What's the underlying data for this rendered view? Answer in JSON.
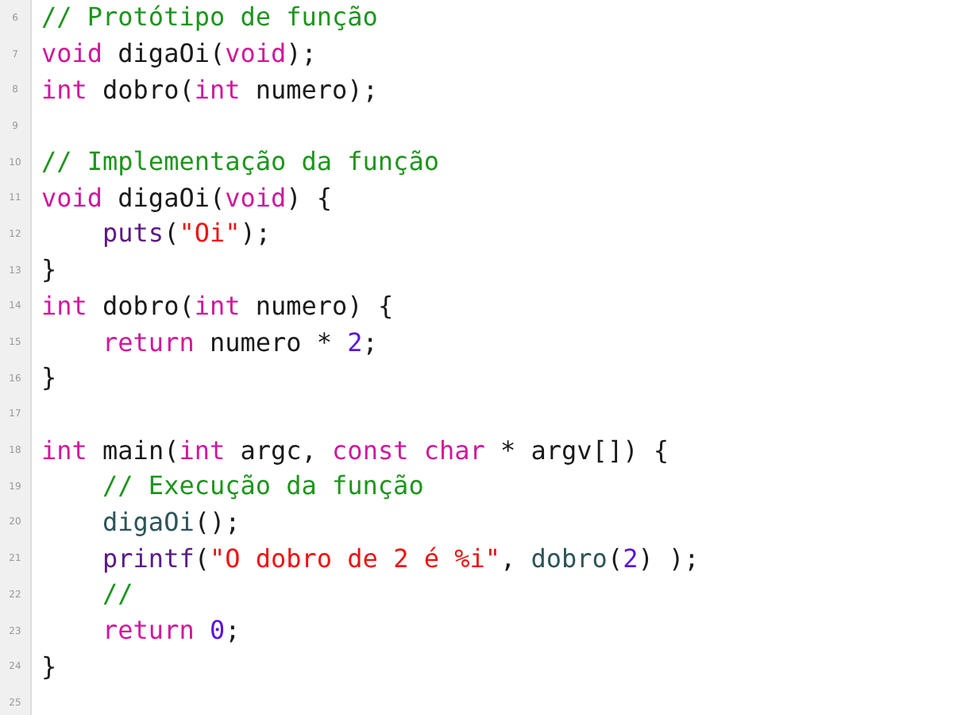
{
  "editor": {
    "lines": [
      {
        "number": "6",
        "tokens": [
          {
            "kind": "comment",
            "text": "// Protótipo de função"
          }
        ]
      },
      {
        "number": "7",
        "tokens": [
          {
            "kind": "keyword",
            "text": "void"
          },
          {
            "kind": "plain",
            "text": " digaOi("
          },
          {
            "kind": "keyword",
            "text": "void"
          },
          {
            "kind": "plain",
            "text": ");"
          }
        ]
      },
      {
        "number": "8",
        "tokens": [
          {
            "kind": "keyword",
            "text": "int"
          },
          {
            "kind": "plain",
            "text": " dobro("
          },
          {
            "kind": "keyword",
            "text": "int"
          },
          {
            "kind": "plain",
            "text": " numero);"
          }
        ]
      },
      {
        "number": "9"
      },
      {
        "number": "10",
        "tokens": [
          {
            "kind": "comment",
            "text": "// Implementação da função"
          }
        ]
      },
      {
        "number": "11",
        "tokens": [
          {
            "kind": "keyword",
            "text": "void"
          },
          {
            "kind": "plain",
            "text": " digaOi("
          },
          {
            "kind": "keyword",
            "text": "void"
          },
          {
            "kind": "plain",
            "text": ") {"
          }
        ]
      },
      {
        "number": "12",
        "tokens": [
          {
            "kind": "builtin",
            "text": "    puts"
          },
          {
            "kind": "plain",
            "text": "("
          },
          {
            "kind": "string",
            "text": "\"Oi\""
          },
          {
            "kind": "plain",
            "text": ");"
          }
        ]
      },
      {
        "number": "13",
        "tokens": [
          {
            "kind": "plain",
            "text": "}"
          }
        ]
      },
      {
        "number": "14",
        "tokens": [
          {
            "kind": "keyword",
            "text": "int"
          },
          {
            "kind": "plain",
            "text": " dobro("
          },
          {
            "kind": "keyword",
            "text": "int"
          },
          {
            "kind": "plain",
            "text": " numero) {"
          }
        ]
      },
      {
        "number": "15",
        "tokens": [
          {
            "kind": "keyword",
            "text": "    return"
          },
          {
            "kind": "plain",
            "text": " numero * "
          },
          {
            "kind": "number",
            "text": "2"
          },
          {
            "kind": "plain",
            "text": ";"
          }
        ]
      },
      {
        "number": "16",
        "tokens": [
          {
            "kind": "plain",
            "text": "}"
          }
        ]
      },
      {
        "number": "17"
      },
      {
        "number": "18",
        "tokens": [
          {
            "kind": "keyword",
            "text": "int"
          },
          {
            "kind": "plain",
            "text": " main("
          },
          {
            "kind": "keyword",
            "text": "int"
          },
          {
            "kind": "plain",
            "text": " argc, "
          },
          {
            "kind": "keyword",
            "text": "const char"
          },
          {
            "kind": "plain",
            "text": " * argv[]) {"
          }
        ]
      },
      {
        "number": "19",
        "tokens": [
          {
            "kind": "comment",
            "text": "    // Execução da função"
          }
        ]
      },
      {
        "number": "20",
        "tokens": [
          {
            "kind": "call",
            "text": "    digaOi"
          },
          {
            "kind": "plain",
            "text": "();"
          }
        ]
      },
      {
        "number": "21",
        "tokens": [
          {
            "kind": "builtin",
            "text": "    printf"
          },
          {
            "kind": "plain",
            "text": "("
          },
          {
            "kind": "string",
            "text": "\"O dobro de 2 é %i\""
          },
          {
            "kind": "plain",
            "text": ", "
          },
          {
            "kind": "call",
            "text": "dobro"
          },
          {
            "kind": "plain",
            "text": "("
          },
          {
            "kind": "number",
            "text": "2"
          },
          {
            "kind": "plain",
            "text": ") );"
          }
        ]
      },
      {
        "number": "22",
        "tokens": [
          {
            "kind": "comment",
            "text": "    //"
          }
        ]
      },
      {
        "number": "23",
        "tokens": [
          {
            "kind": "keyword",
            "text": "    return "
          },
          {
            "kind": "number",
            "text": "0"
          },
          {
            "kind": "plain",
            "text": ";"
          }
        ]
      },
      {
        "number": "24",
        "tokens": [
          {
            "kind": "plain",
            "text": "}"
          }
        ]
      },
      {
        "number": "25"
      }
    ]
  }
}
